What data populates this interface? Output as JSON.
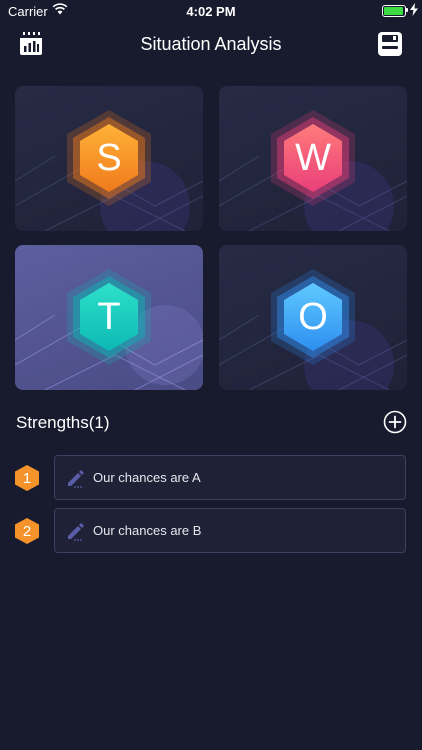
{
  "status_bar": {
    "carrier": "Carrier",
    "time": "4:02 PM",
    "battery_level": 0.95,
    "battery_color": "#3ddc45"
  },
  "nav": {
    "title": "Situation Analysis",
    "left_icon": "calendar-chart-icon",
    "right_icon": "save-icon"
  },
  "swot": [
    {
      "letter": "S",
      "color_start": "#ffb238",
      "color_end": "#f07a1c",
      "selected": false
    },
    {
      "letter": "W",
      "color_start": "#ff7b7b",
      "color_end": "#ea3f79",
      "selected": false
    },
    {
      "letter": "T",
      "color_start": "#2ee0c9",
      "color_end": "#0cb9b5",
      "selected": true
    },
    {
      "letter": "O",
      "color_start": "#5fcaff",
      "color_end": "#2e8ef0",
      "selected": false
    }
  ],
  "section": {
    "title": "Strengths(1)",
    "add_icon": "plus-circle-icon"
  },
  "items": [
    {
      "number": "1",
      "text": "Our chances are A"
    },
    {
      "number": "2",
      "text": "Our chances are B"
    }
  ],
  "colors": {
    "background": "#181b2e",
    "badge": "#f5932b"
  }
}
